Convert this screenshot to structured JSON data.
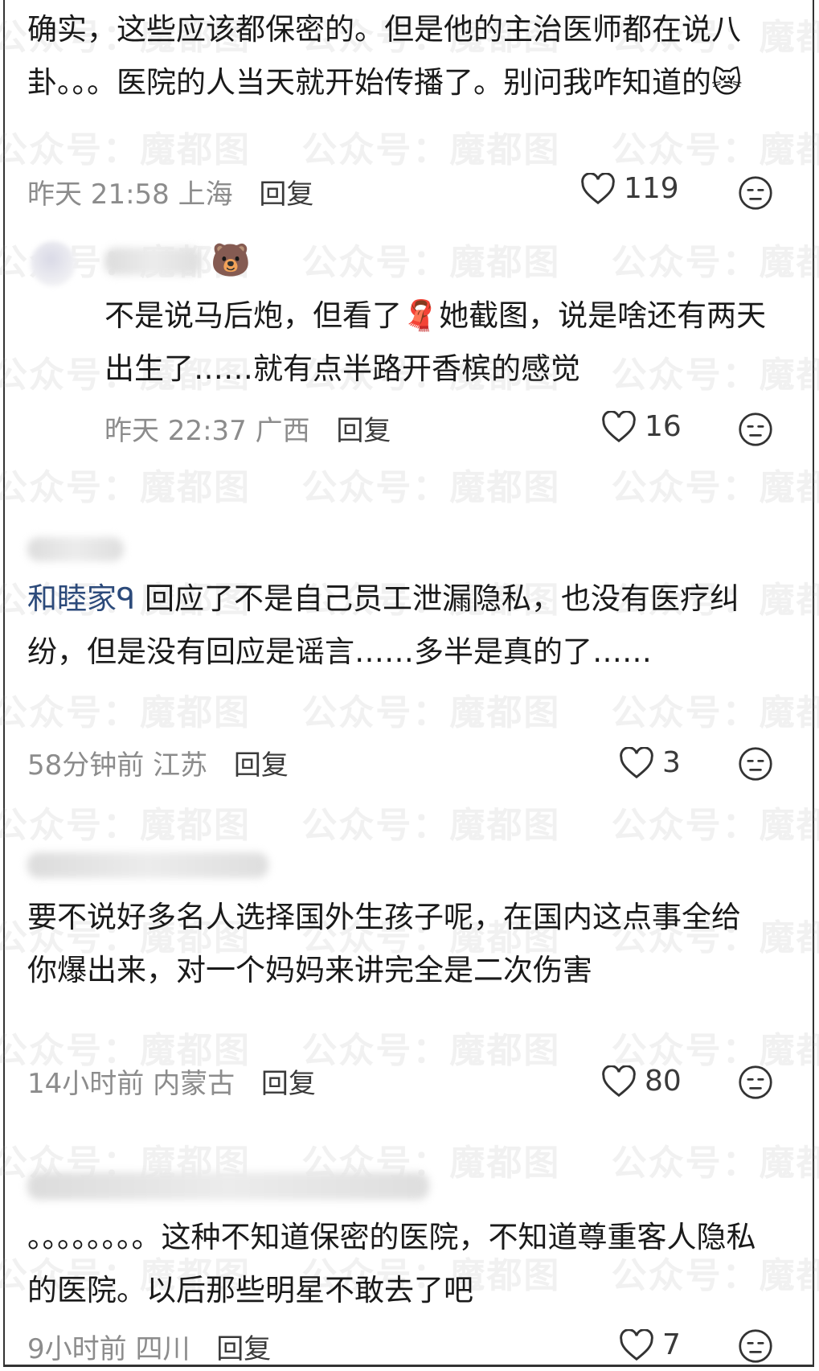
{
  "comments": [
    {
      "text": "确实，这些应该都保密的。但是他的主治医师都在说八卦。。。医院的人当天就开始传播了。别问我咋知道的😿",
      "time": "昨天 21:58",
      "location": "上海",
      "reply": "回复",
      "likes": "119"
    },
    {
      "emoji": "🐻",
      "text": "不是说马后炮，但看了🧣她截图，说是啥还有两天出生了……就有点半路开香槟的感觉",
      "time": "昨天 22:37",
      "location": "广西",
      "reply": "回复",
      "likes": "16"
    },
    {
      "mention": "和睦家ᑫ",
      "text": "回应了不是自己员工泄漏隐私，也没有医疗纠纷，但是没有回应是谣言……多半是真的了……",
      "time": "58分钟前",
      "location": "江苏",
      "reply": "回复",
      "likes": "3"
    },
    {
      "text": "要不说好多名人选择国外生孩子呢，在国内这点事全给你爆出来，对一个妈妈来讲完全是二次伤害",
      "time": "14小时前",
      "location": "内蒙古",
      "reply": "回复",
      "likes": "80"
    },
    {
      "text": "。。。。。。。。这种不知道保密的医院，不知道尊重客人隐私的医院。以后那些明星不敢去了吧",
      "time": "9小时前",
      "location": "四川",
      "reply": "回复",
      "likes": "7"
    }
  ],
  "watermark": "公众号：魔都图"
}
